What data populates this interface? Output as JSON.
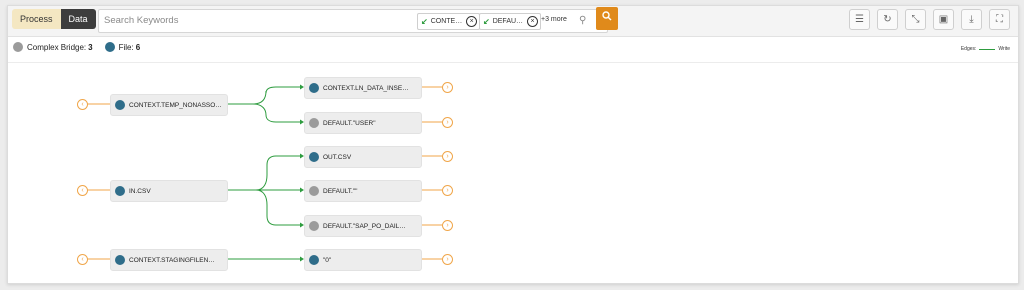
{
  "colors": {
    "accent": "#e08a1b",
    "edge_write": "#2e9c3f",
    "file_icon": "#2f6d8a",
    "bridge_icon": "#9b9b9b",
    "endpoint": "#f0a64a"
  },
  "toolbar": {
    "tab_process": "Process",
    "tab_data": "Data",
    "search_placeholder": "Search Keywords",
    "chips": [
      {
        "label": "CONTE…",
        "icon": "arrow-icon"
      },
      {
        "label": "DEFAU…",
        "icon": "arrow-icon"
      }
    ],
    "more": "+3 more",
    "buttons": [
      "filter-settings-icon",
      "refresh-icon",
      "collapse-icon",
      "save-icon",
      "download-icon",
      "fullscreen-icon"
    ]
  },
  "summary": {
    "bridge_label": "Complex Bridge:",
    "bridge_count": "3",
    "file_label": "File:",
    "file_count": "6"
  },
  "legend": {
    "edges_label": "Edges:",
    "write_label": "Write"
  },
  "nodes": {
    "src1": {
      "label": "CONTEXT.TEMP_NONASSO…",
      "kind": "file"
    },
    "src2": {
      "label": "IN.CSV",
      "kind": "file"
    },
    "src3": {
      "label": "CONTEXT.STAGINGFILEN…",
      "kind": "file"
    },
    "t1": {
      "label": "CONTEXT.LN_DATA_INSE…",
      "kind": "file"
    },
    "t2": {
      "label": "DEFAULT.\"USER\"",
      "kind": "bridge"
    },
    "t3": {
      "label": "OUT.CSV",
      "kind": "file"
    },
    "t4": {
      "label": "DEFAULT.\"\"",
      "kind": "bridge"
    },
    "t5": {
      "label": "DEFAULT.\"SAP_PO_DAIL…",
      "kind": "bridge"
    },
    "t6": {
      "label": "\"0\"",
      "kind": "file"
    }
  }
}
